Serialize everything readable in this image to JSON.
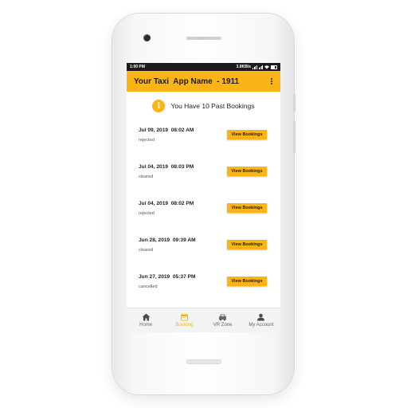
{
  "status_bar": {
    "time": "1:00 PM",
    "network_speed": "3.8KB/s",
    "signal_icon": "signal-icon",
    "wifi_icon": "wifi-icon",
    "battery_icon": "battery-icon"
  },
  "app_bar": {
    "title": "Your Taxi  App Name  - 1911",
    "menu_icon": "overflow-menu-icon"
  },
  "summary": {
    "icon": "info-icon",
    "icon_glyph": "i",
    "text": "You Have 10 Past Bookings"
  },
  "bookings": [
    {
      "date": "Jul 09, 2019  08:02 AM",
      "status": "rejected",
      "button": "View Bookings"
    },
    {
      "date": "Jul 04, 2019  08:03 PM",
      "status": "cleared",
      "button": "View Bookings"
    },
    {
      "date": "Jul 04, 2019  08:02 PM",
      "status": "rejected",
      "button": "View Bookings"
    },
    {
      "date": "Jun 28, 2019  09:39 AM",
      "status": "cleared",
      "button": "View Bookings"
    },
    {
      "date": "Jun 27, 2019  05:37 PM",
      "status": "cancelled",
      "button": "View Bookings"
    }
  ],
  "bottom_nav": [
    {
      "label": "Home",
      "icon": "home-icon",
      "active": false
    },
    {
      "label": "Booking",
      "icon": "calendar-icon",
      "active": true
    },
    {
      "label": "VR Zone",
      "icon": "car-icon",
      "active": false
    },
    {
      "label": "My Account",
      "icon": "person-icon",
      "active": false
    }
  ],
  "colors": {
    "accent": "#fbb415",
    "status_bar": "#1b1b1b",
    "nav_inactive": "#666666"
  }
}
